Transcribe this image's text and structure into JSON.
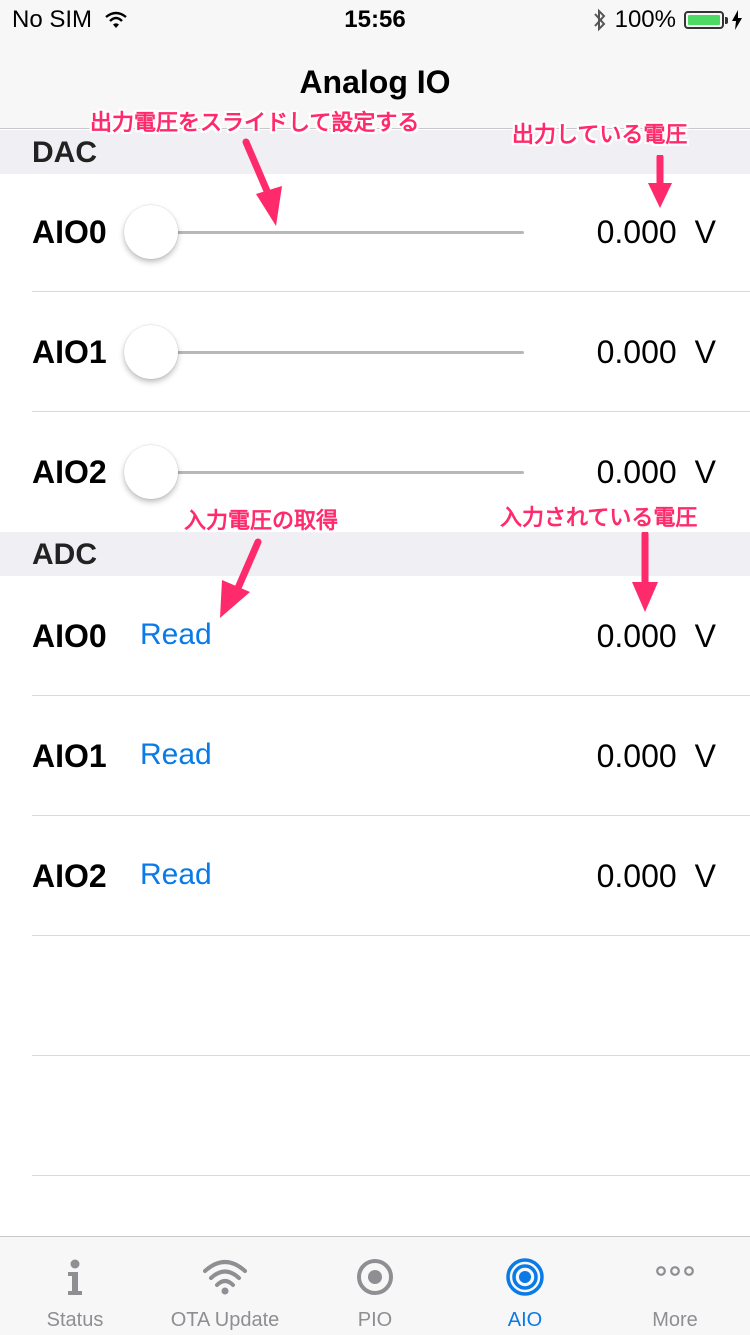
{
  "status_bar": {
    "carrier": "No SIM",
    "time": "15:56",
    "battery_pct": "100%"
  },
  "nav": {
    "title": "Analog IO"
  },
  "dac": {
    "header": "DAC",
    "rows": [
      {
        "label": "AIO0",
        "value": "0.000",
        "unit": "V",
        "slider_level": 0
      },
      {
        "label": "AIO1",
        "value": "0.000",
        "unit": "V",
        "slider_level": 0
      },
      {
        "label": "AIO2",
        "value": "0.000",
        "unit": "V",
        "slider_level": 0
      }
    ]
  },
  "adc": {
    "header": "ADC",
    "rows": [
      {
        "label": "AIO0",
        "button": "Read",
        "value": "0.000",
        "unit": "V"
      },
      {
        "label": "AIO1",
        "button": "Read",
        "value": "0.000",
        "unit": "V"
      },
      {
        "label": "AIO2",
        "button": "Read",
        "value": "0.000",
        "unit": "V"
      }
    ]
  },
  "annotations": {
    "slider_note": "出力電圧をスライドして設定する",
    "output_note": "出力している電圧",
    "read_note": "入力電圧の取得",
    "input_note": "入力されている電圧"
  },
  "tabs": [
    {
      "label": "Status",
      "icon": "info-icon",
      "active": false
    },
    {
      "label": "OTA Update",
      "icon": "wifi-icon",
      "active": false
    },
    {
      "label": "PIO",
      "icon": "radio-icon",
      "active": false
    },
    {
      "label": "AIO",
      "icon": "radio-icon",
      "active": true
    },
    {
      "label": "More",
      "icon": "more-icon",
      "active": false
    }
  ],
  "colors": {
    "accent": "#0a7ae6",
    "annotation": "#ff2a6b",
    "battery": "#4cd964"
  }
}
